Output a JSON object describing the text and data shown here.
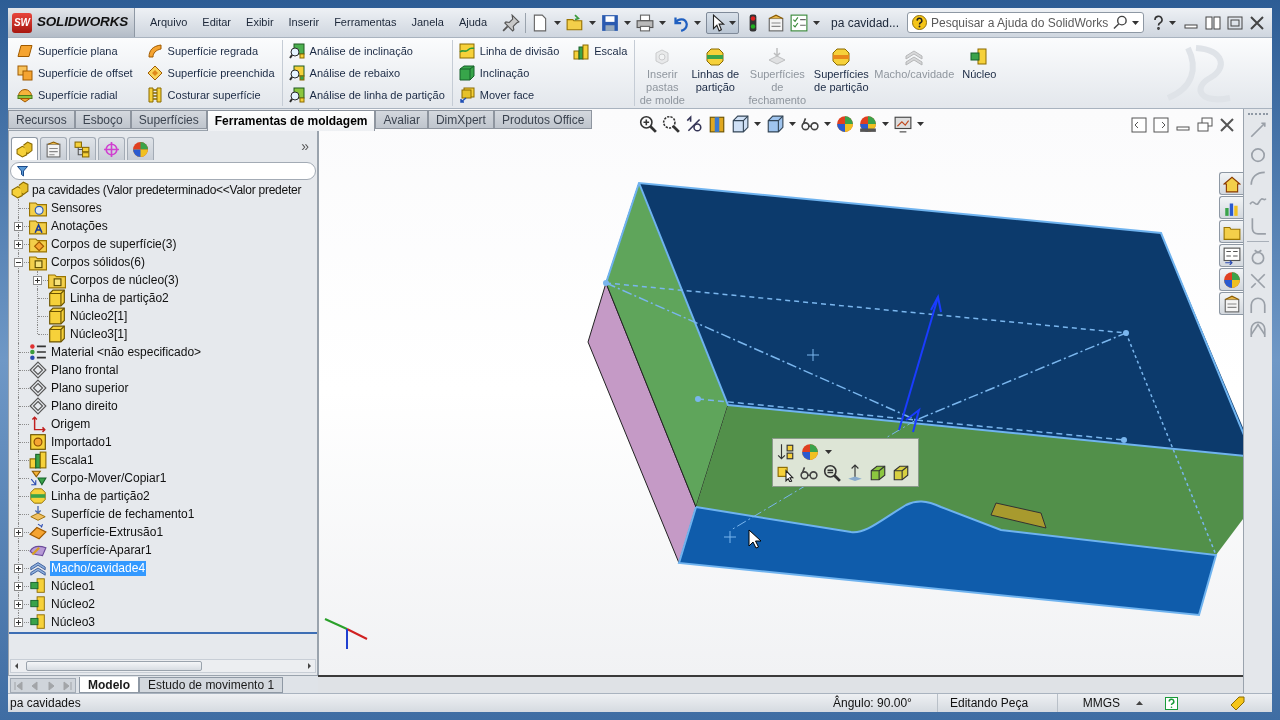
{
  "logo": {
    "badge": "SW",
    "text": "SOLIDWORKS"
  },
  "menu": [
    "Arquivo",
    "Editar",
    "Exibir",
    "Inserir",
    "Ferramentas",
    "Janela",
    "Ajuda"
  ],
  "document_title": "pa cavidad...",
  "search": {
    "placeholder": "Pesquisar a Ajuda do SolidWorks"
  },
  "ribbon": {
    "tool_groups": [
      [
        [
          {
            "label": "Superfície plana",
            "kind": "planar"
          },
          {
            "label": "Superfície de offset",
            "kind": "offset"
          },
          {
            "label": "Superfície radial",
            "kind": "radiate"
          }
        ],
        [
          {
            "label": "Superfície regrada",
            "kind": "ruled"
          },
          {
            "label": "Superfície preenchida",
            "kind": "filled"
          },
          {
            "label": "Costurar superfície",
            "kind": "knit"
          }
        ]
      ],
      [
        [
          {
            "label": "Análise de inclinação",
            "kind": "draft-analysis"
          },
          {
            "label": "Análise de rebaixo",
            "kind": "undercut"
          },
          {
            "label": "Análise de linha de partição",
            "kind": "parting-analysis"
          }
        ]
      ],
      [
        [
          {
            "label": "Linha de divisão",
            "kind": "split-line"
          },
          {
            "label": "Inclinação",
            "kind": "draft"
          },
          {
            "label": "Mover face",
            "kind": "move-face"
          }
        ],
        [
          {
            "label": "Escala",
            "kind": "scale"
          }
        ]
      ]
    ],
    "large_tools": [
      {
        "label": "Inserir pastas de molde",
        "kind": "mold-folders",
        "disabled": true
      },
      {
        "label": "Linhas de partição",
        "kind": "parting-lines",
        "disabled": false
      },
      {
        "label": "Superfícies de fechamento",
        "kind": "shutoff",
        "disabled": true
      },
      {
        "label": "Superfícies de partição",
        "kind": "parting-surface",
        "disabled": false
      },
      {
        "label": "Macho/cavidade",
        "kind": "core-cavity",
        "disabled": true
      },
      {
        "label": "Núcleo",
        "kind": "core",
        "disabled": false
      }
    ]
  },
  "command_tabs": [
    {
      "label": "Recursos",
      "selected": false
    },
    {
      "label": "Esboço",
      "selected": false
    },
    {
      "label": "Superfícies",
      "selected": false
    },
    {
      "label": "Ferramentas de moldagem",
      "selected": true
    },
    {
      "label": "Avaliar",
      "selected": false
    },
    {
      "label": "DimXpert",
      "selected": false
    },
    {
      "label": "Produtos Office",
      "selected": false
    }
  ],
  "feature_panel": {
    "tabs": [
      {
        "kind": "feature-tree",
        "selected": true
      },
      {
        "kind": "property",
        "selected": false
      },
      {
        "kind": "configuration",
        "selected": false
      },
      {
        "kind": "dimxpert",
        "selected": false
      },
      {
        "kind": "display",
        "selected": false
      }
    ],
    "overflow": "»",
    "tree": {
      "label": "pa cavidades (Valor predeterminado<<Valor predeter",
      "kind": "part",
      "selected": false,
      "children": [
        {
          "label": "Sensores",
          "kind": "sensors",
          "selected": false
        },
        {
          "label": "Anotações",
          "kind": "annotations",
          "selected": false,
          "expanded": false
        },
        {
          "label": "Corpos de superfície(3)",
          "kind": "surface-bodies",
          "selected": false,
          "expanded": false
        },
        {
          "label": "Corpos sólidos(6)",
          "kind": "solid-bodies",
          "selected": false,
          "expanded": true,
          "children": [
            {
              "label": "Corpos de núcleo(3)",
              "kind": "solid-bodies",
              "selected": false,
              "expanded": false
            },
            {
              "label": "Linha de partição2",
              "kind": "body",
              "selected": false
            },
            {
              "label": "Núcleo2[1]",
              "kind": "body",
              "selected": false
            },
            {
              "label": "Núcleo3[1]",
              "kind": "body",
              "selected": false
            }
          ]
        },
        {
          "label": "Material <não especificado>",
          "kind": "material",
          "selected": false
        },
        {
          "label": "Plano frontal",
          "kind": "plane",
          "selected": false
        },
        {
          "label": "Plano superior",
          "kind": "plane",
          "selected": false
        },
        {
          "label": "Plano direito",
          "kind": "plane",
          "selected": false
        },
        {
          "label": "Origem",
          "kind": "origin",
          "selected": false
        },
        {
          "label": "Importado1",
          "kind": "imported",
          "selected": false
        },
        {
          "label": "Escala1",
          "kind": "scale",
          "selected": false
        },
        {
          "label": "Corpo-Mover/Copiar1",
          "kind": "move-copy",
          "selected": false
        },
        {
          "label": "Linha de partição2",
          "kind": "parting-lines",
          "selected": false
        },
        {
          "label": "Superfície de fechamento1",
          "kind": "shutoff",
          "selected": false
        },
        {
          "label": "Superfície-Extrusão1",
          "kind": "extrude",
          "selected": false,
          "expanded": false
        },
        {
          "label": "Superfície-Aparar1",
          "kind": "trim",
          "selected": false
        },
        {
          "label": "Macho/cavidade4",
          "kind": "core-cavity",
          "selected": true,
          "expanded": false
        },
        {
          "label": "Núcleo1",
          "kind": "core",
          "selected": false,
          "expanded": false
        },
        {
          "label": "Núcleo2",
          "kind": "core",
          "selected": false,
          "expanded": false
        },
        {
          "label": "Núcleo3",
          "kind": "core",
          "selected": false,
          "expanded": false
        }
      ]
    }
  },
  "bottom_tabs": [
    {
      "label": "Modelo",
      "selected": true
    },
    {
      "label": "Estudo de movimento 1",
      "selected": false
    }
  ],
  "status_bar": {
    "document": "pa cavidades",
    "angle": "Ângulo: 90.00°",
    "mode": "Editando Peça",
    "units": "MMGS"
  }
}
